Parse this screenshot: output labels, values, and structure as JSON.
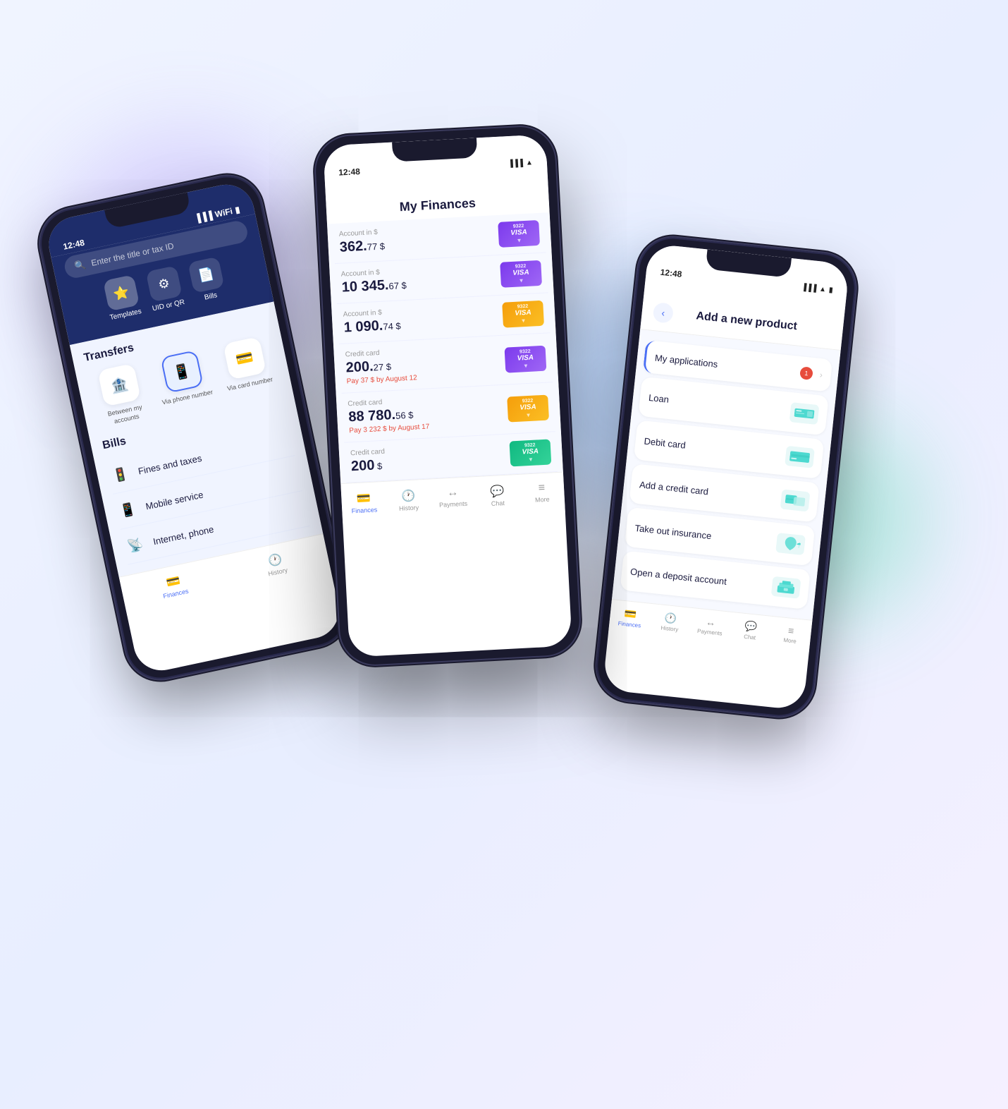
{
  "background": {
    "color1": "#f0f4ff",
    "color2": "#e8eeff",
    "color3": "#f5f0ff"
  },
  "left_phone": {
    "status_time": "12:48",
    "search_placeholder": "Enter the title or tax ID",
    "quick_actions": [
      {
        "icon": "⭐",
        "label": "Templates"
      },
      {
        "icon": "⚙",
        "label": "UID or QR"
      },
      {
        "icon": "📄",
        "label": "Bills"
      }
    ],
    "transfers_section": "Transfers",
    "transfers": [
      {
        "icon": "🏦",
        "label": "Between my accounts",
        "active": false
      },
      {
        "icon": "📱",
        "label": "Via phone number",
        "active": true
      },
      {
        "icon": "💳",
        "label": "Via card number",
        "active": false
      }
    ],
    "bills_section": "Bills",
    "bills": [
      {
        "icon": "🚦",
        "label": "Fines and taxes"
      },
      {
        "icon": "📱",
        "label": "Mobile service"
      },
      {
        "icon": "📡",
        "label": "Internet, phone"
      }
    ],
    "bottom_nav": [
      {
        "icon": "💳",
        "label": "Finances",
        "active": true
      },
      {
        "icon": "🕐",
        "label": "History",
        "active": false
      }
    ]
  },
  "center_phone": {
    "status_time": "12:48",
    "title": "My Finances",
    "accounts": [
      {
        "label": "Account in $",
        "amount": "362.",
        "cents": "77 $",
        "card_color": "purple",
        "card_num": "9322",
        "has_sub": false
      },
      {
        "label": "Account in $",
        "amount": "10 345.",
        "cents": "67 $",
        "card_color": "purple",
        "card_num": "9322",
        "has_sub": false
      },
      {
        "label": "Account in $",
        "amount": "1 090.",
        "cents": "74 $",
        "card_color": "orange",
        "card_num": "9322",
        "has_sub": false
      },
      {
        "label": "Credit card",
        "amount": "200.",
        "cents": "27 $",
        "sub": "Pay 37 $ by August 12",
        "card_color": "purple",
        "card_num": "9322",
        "has_sub": true
      },
      {
        "label": "Credit card",
        "amount": "88 780.",
        "cents": "56 $",
        "sub": "Pay 3 232 $ by August 17",
        "card_color": "orange",
        "card_num": "9322",
        "has_sub": true
      },
      {
        "label": "Credit card",
        "amount": "200",
        "cents": " $",
        "card_color": "green",
        "card_num": "9322",
        "has_sub": false
      }
    ],
    "bottom_nav": [
      {
        "icon": "💳",
        "label": "Finances",
        "active": true
      },
      {
        "icon": "🕐",
        "label": "History",
        "active": false
      },
      {
        "icon": "↔",
        "label": "Payments",
        "active": false
      },
      {
        "icon": "💬",
        "label": "Chat",
        "active": false
      },
      {
        "icon": "≡",
        "label": "More",
        "active": false
      }
    ]
  },
  "right_phone": {
    "status_time": "12:48",
    "back_label": "‹",
    "title": "Add a new product",
    "products": [
      {
        "name": "My applications",
        "type": "applications",
        "has_badge": true,
        "badge_count": "1",
        "icon": "›",
        "show_chevron": true
      },
      {
        "name": "Loan",
        "type": "loan",
        "has_badge": false,
        "icon": "💼",
        "show_chevron": false
      },
      {
        "name": "Debit card",
        "type": "debit",
        "has_badge": false,
        "icon": "💳",
        "show_chevron": false
      },
      {
        "name": "Add a credit card",
        "type": "credit",
        "has_badge": false,
        "icon": "💳",
        "show_chevron": false
      },
      {
        "name": "Take out insurance",
        "type": "insurance",
        "has_badge": false,
        "icon": "☂",
        "show_chevron": false
      },
      {
        "name": "Open a deposit account",
        "type": "deposit",
        "has_badge": false,
        "icon": "🏦",
        "show_chevron": false
      }
    ],
    "bottom_nav": [
      {
        "icon": "💳",
        "label": "Finances",
        "active": true
      },
      {
        "icon": "🕐",
        "label": "History",
        "active": false
      },
      {
        "icon": "↔",
        "label": "Payments",
        "active": false
      },
      {
        "icon": "💬",
        "label": "Chat",
        "active": false
      },
      {
        "icon": "≡",
        "label": "More",
        "active": false
      }
    ]
  }
}
